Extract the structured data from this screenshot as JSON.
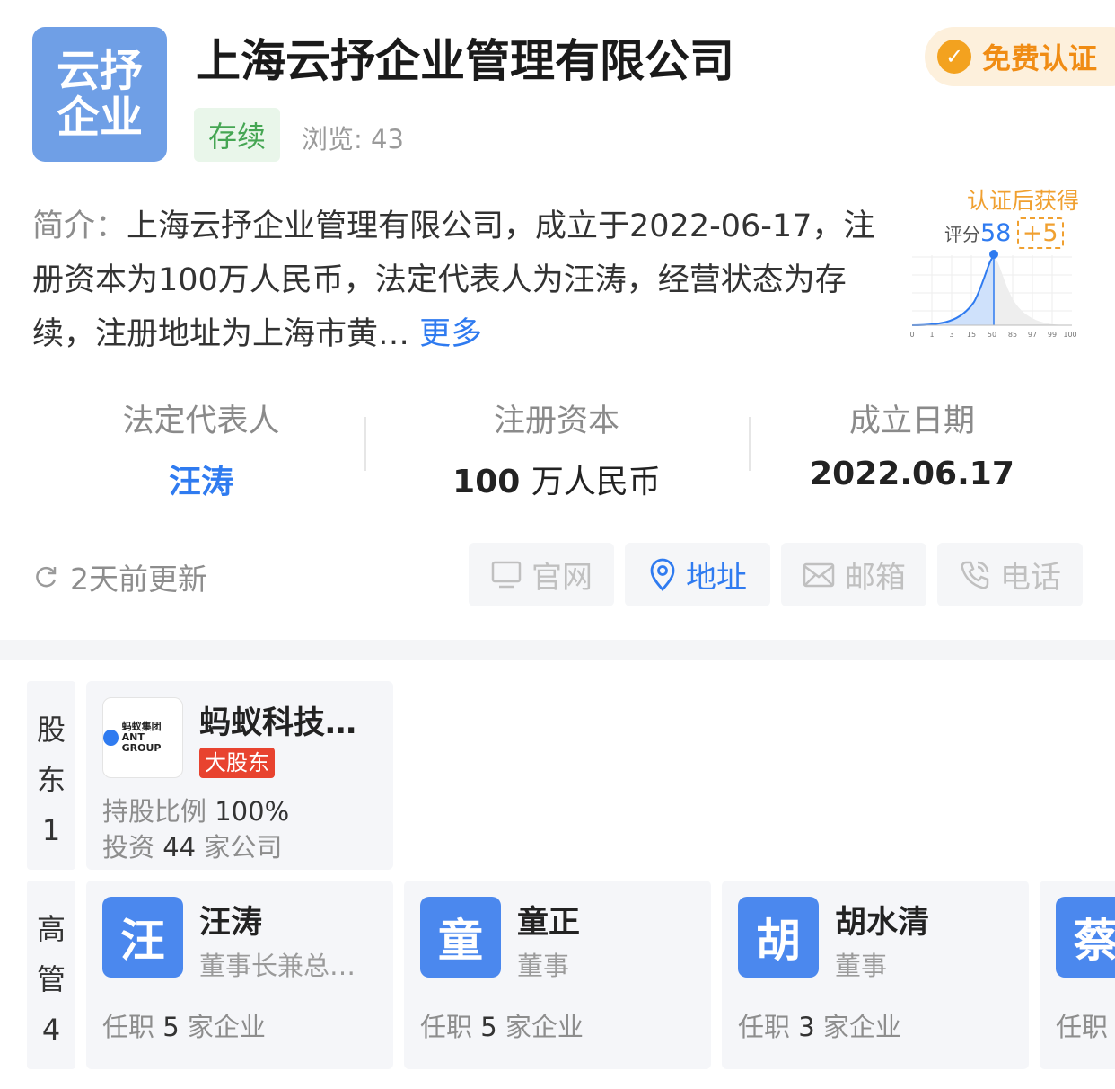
{
  "company": {
    "logo_text_line1": "云抒",
    "logo_text_line2": "企业",
    "name": "上海云抒企业管理有限公司",
    "status": "存续",
    "views_label": "浏览: ",
    "views": "43",
    "cert_button": "免费认证"
  },
  "intro": {
    "label": "简介：",
    "text": "上海云抒企业管理有限公司，成立于2022-06-17，注册资本为100万人民币，法定代表人为汪涛，经营状态为存续，注册地址为上海市黄…",
    "more": "更多"
  },
  "score": {
    "after_cert": "认证后获得",
    "label": "评分",
    "value": "58",
    "bonus": "+5",
    "ticks": [
      "0",
      "1",
      "3",
      "15",
      "50",
      "85",
      "97",
      "99",
      "100"
    ],
    "colors": {
      "curve": "#2f7bf0",
      "fill": "#cfe1fb"
    }
  },
  "stats": {
    "legal_rep_label": "法定代表人",
    "legal_rep": "汪涛",
    "capital_label": "注册资本",
    "capital_num": "100",
    "capital_unit": "万人民币",
    "founded_label": "成立日期",
    "founded": "2022.06.17"
  },
  "updated": "2天前更新",
  "actions": {
    "website": "官网",
    "address": "地址",
    "email": "邮箱",
    "phone": "电话"
  },
  "shareholders": {
    "side_label": "股\n东\n1",
    "side_1": "股",
    "side_2": "东",
    "side_3": "1",
    "items": [
      {
        "logo_line1": "蚂蚁集团",
        "logo_line2": "ANT GROUP",
        "name": "蚂蚁科技…",
        "tag": "大股东",
        "ratio_label": "持股比例 ",
        "ratio": "100%",
        "invest_label": "投资 ",
        "invest_count": "44",
        "invest_suffix": " 家公司"
      }
    ]
  },
  "executives": {
    "side_1": "高",
    "side_2": "管",
    "side_3": "4",
    "items": [
      {
        "avatar": "汪",
        "name": "汪涛",
        "role": "董事长兼总…",
        "jobs_label": "任职 ",
        "jobs": "5",
        "jobs_suffix": " 家企业"
      },
      {
        "avatar": "童",
        "name": "童正",
        "role": "董事",
        "jobs_label": "任职 ",
        "jobs": "5",
        "jobs_suffix": " 家企业"
      },
      {
        "avatar": "胡",
        "name": "胡水清",
        "role": "董事",
        "jobs_label": "任职 ",
        "jobs": "3",
        "jobs_suffix": " 家企业"
      },
      {
        "avatar": "蔡",
        "jobs_label": "任职"
      }
    ]
  }
}
